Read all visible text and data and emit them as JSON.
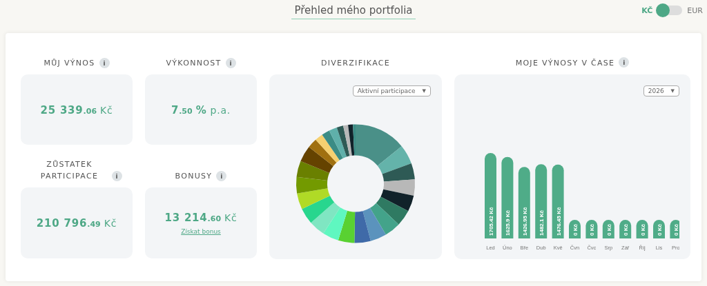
{
  "header": {
    "title": "Přehled mého portfolia",
    "currency": [
      {
        "label": "KČ",
        "selected": true
      },
      {
        "label": "EUR",
        "selected": false
      }
    ]
  },
  "stats": [
    {
      "title": "MŮJ VÝNOS",
      "info": "i",
      "amount": "25 339",
      "decimals": ".06",
      "unit": "Kč"
    },
    {
      "title": "VÝKONNOST",
      "info": "i",
      "amount": "7",
      "decimals": ".50",
      "unit_strong": "%",
      "unit": "p.a."
    },
    {
      "title": "ZŮSTATEK PARTICIPACE",
      "info": "i",
      "amount": "210 796",
      "decimals": ".49",
      "unit": "Kč"
    },
    {
      "title": "BONUSY",
      "info": "i",
      "amount": "13 214",
      "decimals": ".60",
      "unit": "Kč",
      "link": "Získat bonus"
    }
  ],
  "diversification": {
    "title": "DIVERZIFIKACE",
    "dropdown": "Aktivní participace",
    "dropdown_caret": "▼"
  },
  "returns": {
    "title": "MOJE VÝNOSY V ČASE",
    "info": "i",
    "dropdown": "2026",
    "dropdown_caret": "▼",
    "chart_data": {
      "type": "bar",
      "categories": [
        "Led",
        "Úno",
        "Bře",
        "Dub",
        "Kvě",
        "Čvn",
        "Čvc",
        "Srp",
        "Zář",
        "Říj",
        "Lis",
        "Pro"
      ],
      "values": [
        1705.42,
        1625.9,
        1426.95,
        1482.1,
        1476.45,
        0,
        0,
        0,
        0,
        0,
        0,
        0
      ],
      "value_labels": [
        "1705.42 Kč",
        "1625.9 Kč",
        "1426.95 Kč",
        "1482.1 Kč",
        "1476.45 Kč",
        "0 Kč",
        "0 Kč",
        "0 Kč",
        "0 Kč",
        "0 Kč",
        "0 Kč",
        "0 Kč"
      ]
    }
  }
}
